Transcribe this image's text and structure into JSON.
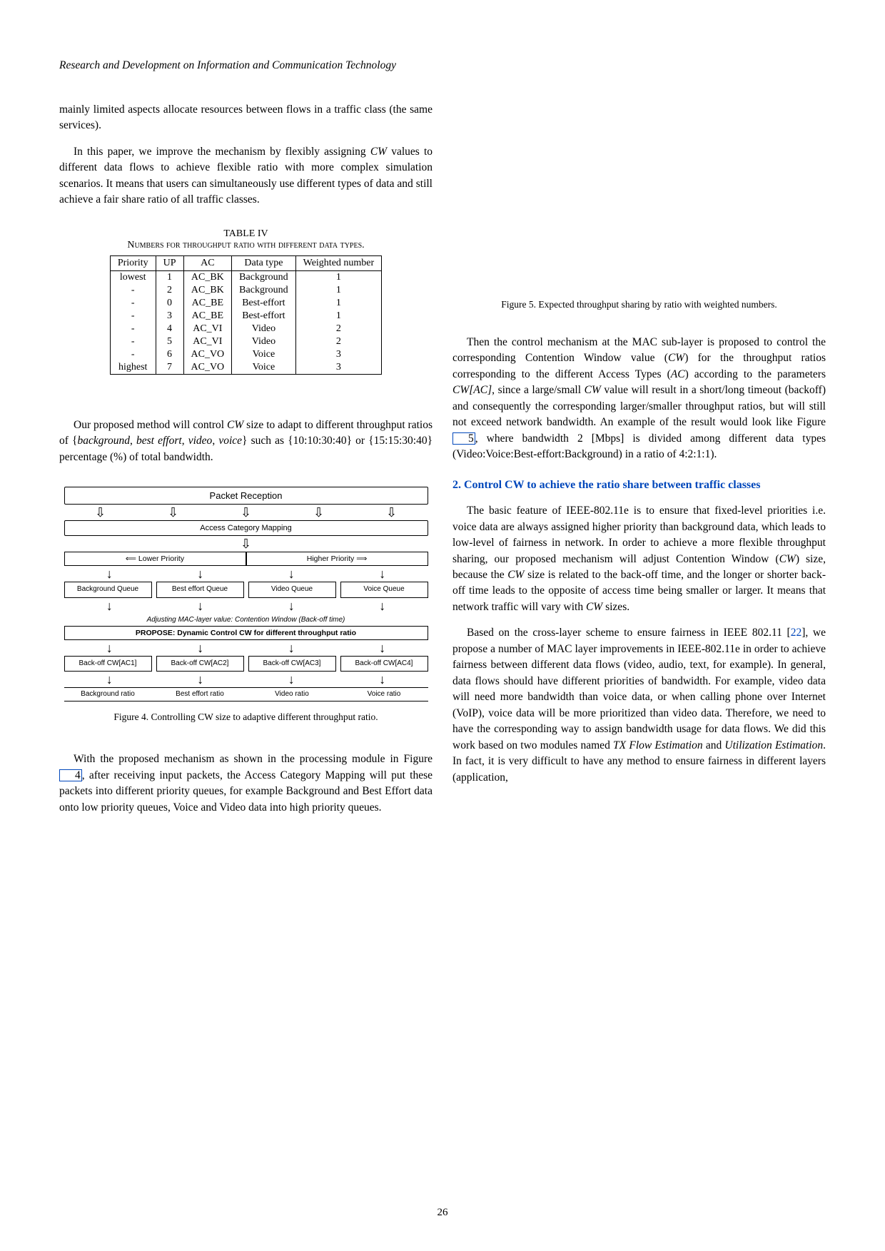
{
  "header": "Research and Development on Information and Communication Technology",
  "page_number": "26",
  "left": {
    "p1": "mainly limited aspects allocate resources between flows in a traffic class (the same services).",
    "p2_a": "In this paper, we improve the mechanism by flexibly assigning ",
    "p2_cw": "CW",
    "p2_b": " values to different data flows to achieve flexible ratio with more complex simulation scenarios. It means that users can simultaneously use different types of data and still achieve a fair share ratio of all traffic classes.",
    "table_caption_1": "TABLE IV",
    "table_caption_2": "Numbers for throughput ratio with different data types.",
    "p3_a": "Our proposed method will control ",
    "p3_cw": "CW",
    "p3_b": " size to adapt to different throughput ratios of {",
    "p3_bg": "background",
    "p3_c": ", ",
    "p3_be": "best effort",
    "p3_d": ", ",
    "p3_vi": "video",
    "p3_e": ", ",
    "p3_vo": "voice",
    "p3_f": "} such as {10:10:30:40} or {15:15:30:40} percentage (%) of total bandwidth.",
    "fig4_caption": "Figure 4.   Controlling CW size to adaptive different throughput ratio.",
    "p4_a": "With the proposed mechanism as shown in the processing module in Figure ",
    "p4_ref": "4",
    "p4_b": ", after receiving input packets, the Access Category Mapping will put these packets into different priority queues, for example Background and Best Effort data onto low priority queues, Voice and Video data into high priority queues.",
    "diagram": {
      "packet_reception": "Packet Reception",
      "access_mapping": "Access Category Mapping",
      "lower_priority": "Lower Priority",
      "higher_priority": "Higher Priority",
      "bg_queue": "Background Queue",
      "be_queue": "Best effort Queue",
      "vi_queue": "Video Queue",
      "vo_queue": "Voice Queue",
      "adjusting": "Adjusting MAC-layer value: Contention Window (Back-off time)",
      "propose": "PROPOSE: Dynamic Control CW for different throughput ratio",
      "backoff1": "Back-off CW[AC1]",
      "backoff2": "Back-off CW[AC2]",
      "backoff3": "Back-off CW[AC3]",
      "backoff4": "Back-off CW[AC4]",
      "ratio1": "Background ratio",
      "ratio2": "Best effort ratio",
      "ratio3": "Video ratio",
      "ratio4": "Voice ratio"
    }
  },
  "right": {
    "fig5_caption": "Figure 5.   Expected throughput sharing by ratio with weighted numbers.",
    "p1_a": "Then the control mechanism at the MAC sub-layer is proposed to control the corresponding Contention Window value (",
    "p1_cw": "CW",
    "p1_b": ") for the throughput ratios corresponding to the different Access Types (",
    "p1_ac": "AC",
    "p1_c": ") according to the parameters ",
    "p1_cwac": "CW[AC]",
    "p1_d": ", since a large/small ",
    "p1_cw2": "CW",
    "p1_e": " value will result in a short/long timeout (backoff) and consequently the corresponding larger/smaller throughput ratios, but will still not exceed network bandwidth. An example of the result would look like Figure ",
    "p1_ref": "5",
    "p1_f": ", where bandwidth 2 [Mbps] is divided among different data types (Video:Voice:Best-effort:Background) in a ratio of 4:2:1:1).",
    "section": "2. Control CW to achieve the ratio share between traffic classes",
    "p2_a": "The basic feature of IEEE-802.11e is to ensure that fixed-level priorities i.e. voice data are always assigned higher priority than background data, which leads to low-level of fairness in network. In order to achieve a more flexible throughput sharing, our proposed mechanism will adjust Contention Window (",
    "p2_cw": "CW",
    "p2_b": ") size, because the ",
    "p2_cw2": "CW",
    "p2_c": " size is related to the back-off time, and the longer or shorter back-off time leads to the opposite of access time being smaller or larger. It means that network traffic will vary with ",
    "p2_cw3": "CW",
    "p2_d": " sizes.",
    "p3_a": "Based on the cross-layer scheme to ensure fairness in IEEE 802.11 [",
    "p3_ref": "22",
    "p3_b": "], we propose a number of MAC layer improvements in IEEE-802.11e in order to achieve fairness between different data flows (video, audio, text, for example). In general, data flows should have different priorities of bandwidth. For example, video data will need more bandwidth than voice data, or when calling phone over Internet (VoIP), voice data will be more prioritized than video data. Therefore, we need to have the corresponding way to assign bandwidth usage for data flows. We did this work based on two modules named ",
    "p3_tx": "TX Flow Estimation",
    "p3_c": " and ",
    "p3_ue": "Utilization Estimation",
    "p3_d": ". In fact, it is very difficult to have any method to ensure fairness in different layers (application,"
  },
  "chart_data": {
    "type": "table",
    "title": "Numbers for throughput ratio with different data types.",
    "columns": [
      "Priority",
      "UP",
      "AC",
      "Data type",
      "Weighted number"
    ],
    "rows": [
      [
        "lowest",
        "1",
        "AC_BK",
        "Background",
        "1"
      ],
      [
        "-",
        "2",
        "AC_BK",
        "Background",
        "1"
      ],
      [
        "-",
        "0",
        "AC_BE",
        "Best-effort",
        "1"
      ],
      [
        "-",
        "3",
        "AC_BE",
        "Best-effort",
        "1"
      ],
      [
        "-",
        "4",
        "AC_VI",
        "Video",
        "2"
      ],
      [
        "-",
        "5",
        "AC_VI",
        "Video",
        "2"
      ],
      [
        "-",
        "6",
        "AC_VO",
        "Voice",
        "3"
      ],
      [
        "highest",
        "7",
        "AC_VO",
        "Voice",
        "3"
      ]
    ]
  }
}
